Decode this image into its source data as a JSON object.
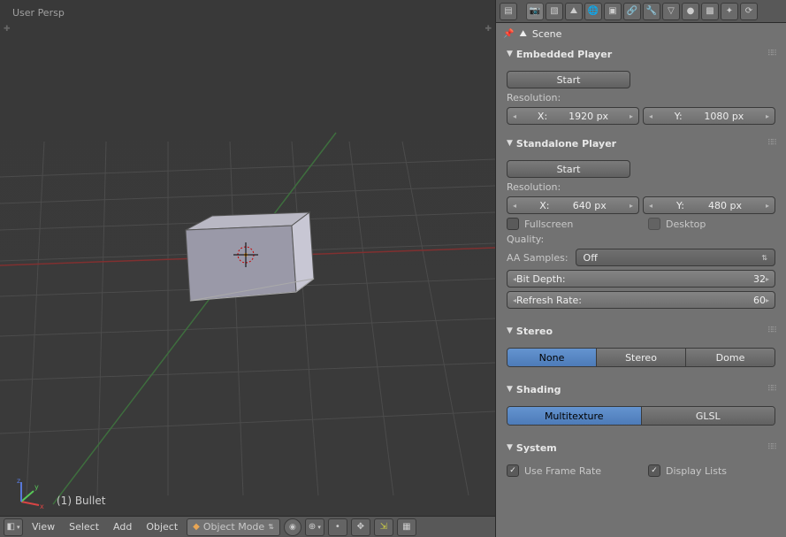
{
  "viewport": {
    "persp_label": "User Persp",
    "object_info": "(1) Bullet",
    "axes": {
      "x": "x",
      "y": "y",
      "z": "z"
    }
  },
  "bottom_header": {
    "menus": {
      "view": "View",
      "select": "Select",
      "add": "Add",
      "object": "Object"
    },
    "mode": "Object Mode"
  },
  "breadcrumb": {
    "scene": "Scene"
  },
  "panels": {
    "embedded_player": {
      "title": "Embedded Player",
      "start": "Start",
      "resolution_label": "Resolution:",
      "x_label": "X:",
      "y_label": "Y:",
      "x_value": "1920 px",
      "y_value": "1080 px"
    },
    "standalone_player": {
      "title": "Standalone Player",
      "start": "Start",
      "resolution_label": "Resolution:",
      "x_label": "X:",
      "y_label": "Y:",
      "x_value": "640 px",
      "y_value": "480 px",
      "fullscreen": "Fullscreen",
      "desktop": "Desktop",
      "quality_label": "Quality:",
      "aa_label": "AA Samples:",
      "aa_value": "Off",
      "bit_depth_label": "Bit Depth:",
      "bit_depth_value": "32",
      "refresh_label": "Refresh Rate:",
      "refresh_value": "60"
    },
    "stereo": {
      "title": "Stereo",
      "none": "None",
      "stereo": "Stereo",
      "dome": "Dome"
    },
    "shading": {
      "title": "Shading",
      "multitexture": "Multitexture",
      "glsl": "GLSL"
    },
    "system": {
      "title": "System",
      "use_frame_rate": "Use Frame Rate",
      "display_lists": "Display Lists"
    }
  }
}
